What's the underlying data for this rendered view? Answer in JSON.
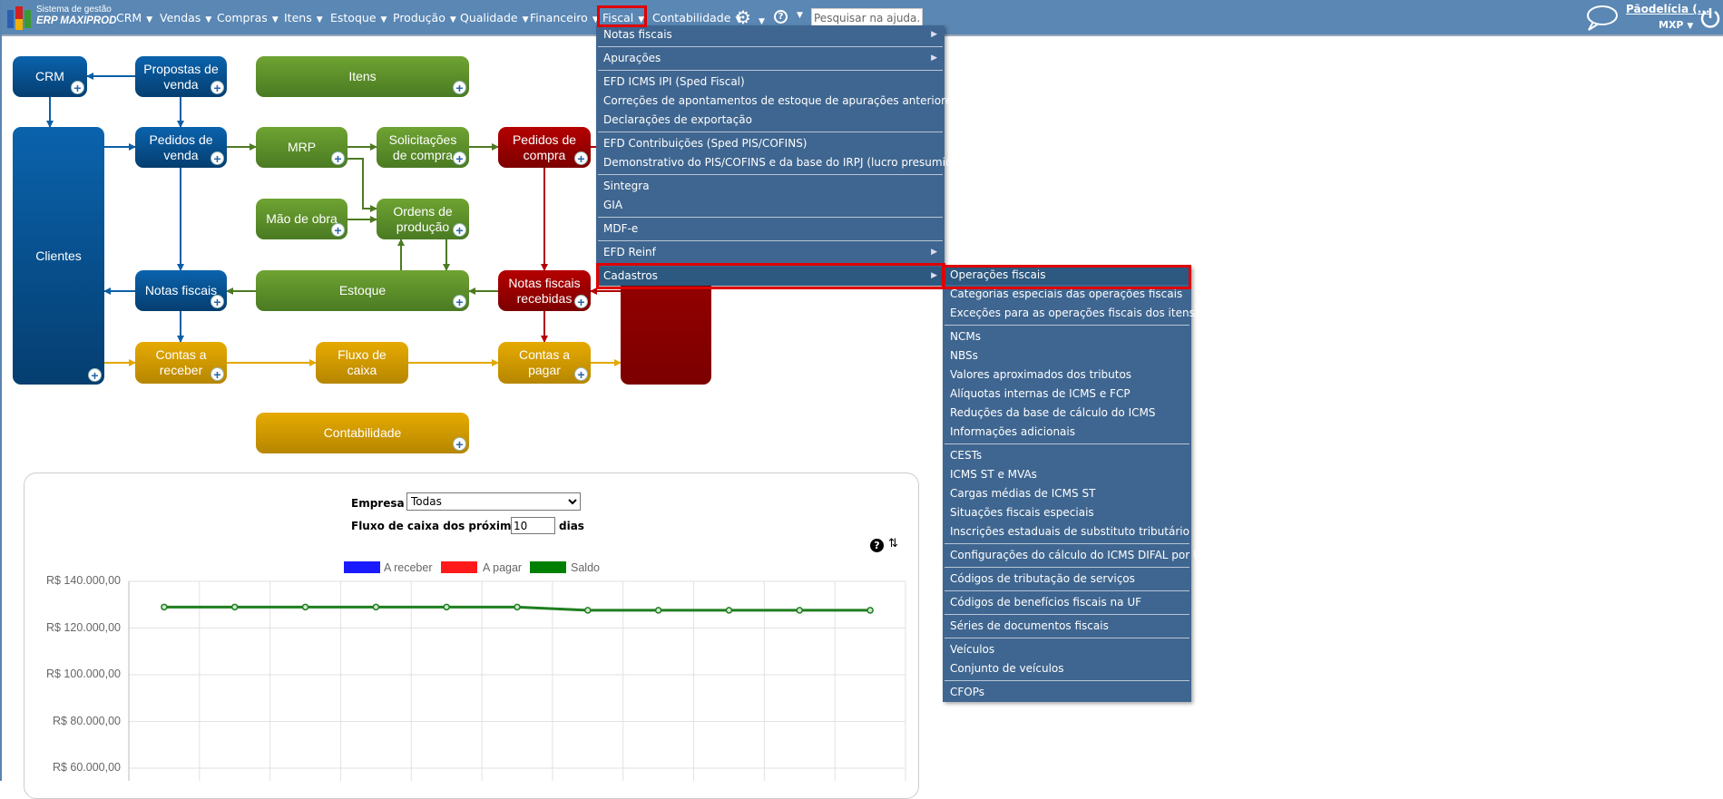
{
  "header": {
    "logo_line1": "Sistema de gestão",
    "logo_line2": "ERP MAXIPROD",
    "nav": [
      "CRM",
      "Vendas",
      "Compras",
      "Itens",
      "Estoque",
      "Produção",
      "Qualidade",
      "Financeiro",
      "Fiscal",
      "Contabilidade"
    ],
    "search_placeholder": "Pesquisar na ajuda...",
    "user": "Pãodelícia (...",
    "company": "MXP"
  },
  "fiscal_menu": [
    {
      "label": "Notas fiscais",
      "sub": true
    },
    {
      "label": "Apurações",
      "sub": true,
      "sep": true
    },
    {
      "label": "EFD ICMS IPI (Sped Fiscal)",
      "sep": true
    },
    {
      "label": "Correções de apontamentos de estoque de apurações anteriores"
    },
    {
      "label": "Declarações de exportação"
    },
    {
      "label": "EFD Contribuições (Sped PIS/COFINS)",
      "sep": true
    },
    {
      "label": "Demonstrativo do PIS/COFINS e da base do IRPJ (lucro presumido)"
    },
    {
      "label": "Sintegra",
      "sep": true
    },
    {
      "label": "GIA"
    },
    {
      "label": "MDF-e",
      "sep": true
    },
    {
      "label": "EFD Reinf",
      "sub": true,
      "sep": true
    },
    {
      "label": "Cadastros",
      "sub": true,
      "sep": true,
      "active": true
    }
  ],
  "cadastros_menu": [
    {
      "label": "Operações fiscais",
      "active": true
    },
    {
      "label": "Categorias especiais das operações fiscais"
    },
    {
      "label": "Exceções para as operações fiscais dos itens"
    },
    {
      "label": "NCMs",
      "sep": true
    },
    {
      "label": "NBSs"
    },
    {
      "label": "Valores aproximados dos tributos"
    },
    {
      "label": "Alíquotas internas de ICMS e FCP"
    },
    {
      "label": "Reduções da base de cálculo do ICMS"
    },
    {
      "label": "Informações adicionais"
    },
    {
      "label": "CESTs",
      "sep": true
    },
    {
      "label": "ICMS ST e MVAs"
    },
    {
      "label": "Cargas médias de ICMS ST"
    },
    {
      "label": "Situações fiscais especiais"
    },
    {
      "label": "Inscrições estaduais de substituto tributário"
    },
    {
      "label": "Configurações do cálculo do ICMS DIFAL por UF",
      "sep": true
    },
    {
      "label": "Códigos de tributação de serviços",
      "sep": true
    },
    {
      "label": "Códigos de benefícios fiscais na UF",
      "sep": true
    },
    {
      "label": "Séries de documentos fiscais",
      "sep": true
    },
    {
      "label": "Veículos",
      "sep": true
    },
    {
      "label": "Conjunto de veículos"
    },
    {
      "label": "CFOPs",
      "sep": true
    }
  ],
  "diagram": {
    "crm": "CRM",
    "propostas": "Propostas de venda",
    "itens": "Itens",
    "clientes": "Clientes",
    "pedidos_venda": "Pedidos de venda",
    "mrp": "MRP",
    "solicitacoes": "Solicitações de compra",
    "pedidos_compra": "Pedidos de compra",
    "mao_obra": "Mão de obra",
    "ordens": "Ordens de produção",
    "notas": "Notas fiscais",
    "estoque": "Estoque",
    "nf_recebidas": "Notas fiscais recebidas",
    "contas_receber": "Contas a receber",
    "fluxo": "Fluxo de caixa",
    "contas_pagar": "Contas a pagar",
    "fornecedores": "",
    "contabilidade": "Contabilidade"
  },
  "panel": {
    "empresa_label": "Empresa",
    "empresa_value": "Todas",
    "fluxo_label": "Fluxo de caixa dos próximos",
    "fluxo_value": "10",
    "dias_label": "dias"
  },
  "chart_data": {
    "type": "line",
    "legend": [
      {
        "name": "A receber",
        "color": "#1a1aff"
      },
      {
        "name": "A pagar",
        "color": "#ff1a1a"
      },
      {
        "name": "Saldo",
        "color": "#008000"
      }
    ],
    "series": [
      {
        "name": "Saldo",
        "values": [
          129000,
          129000,
          129000,
          129000,
          129000,
          129000,
          127600,
          127600,
          127600,
          127600,
          127600
        ]
      }
    ],
    "yticks": [
      "R$ 140.000,00",
      "R$ 120.000,00",
      "R$ 100.000,00",
      "R$ 80.000,00",
      "R$ 60.000,00"
    ],
    "ytick_values": [
      140000,
      120000,
      100000,
      80000,
      60000
    ],
    "legend_placement": "top-center",
    "grid": true
  }
}
